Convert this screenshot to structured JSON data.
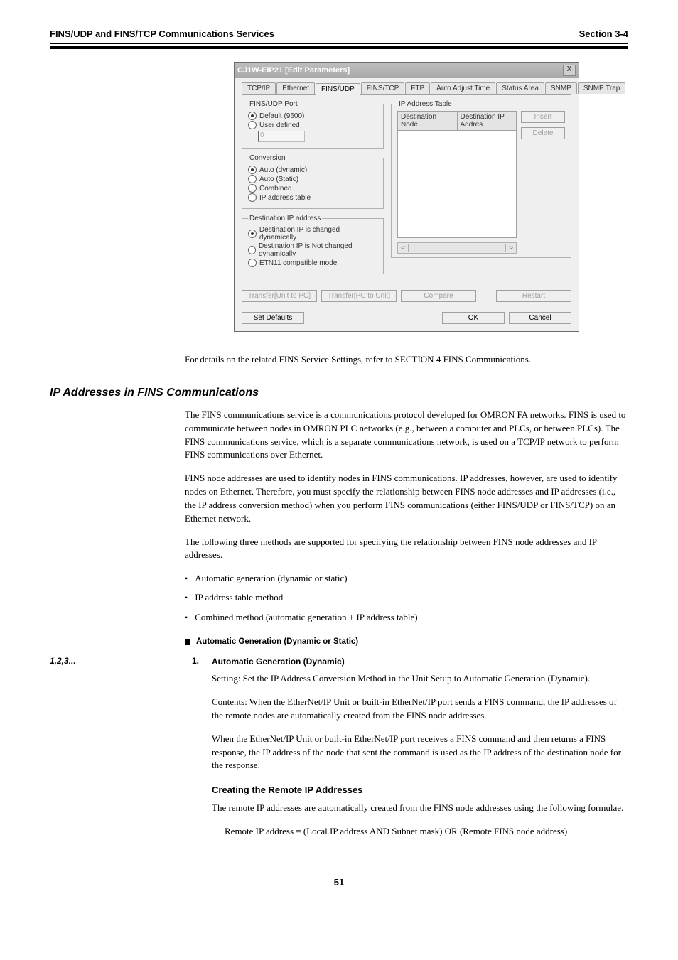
{
  "header": {
    "left": "FINS/UDP and FINS/TCP Communications Services",
    "right": "Section 3-4"
  },
  "dialog": {
    "title": "CJ1W-EIP21 [Edit Parameters]",
    "close": "X",
    "tabs": [
      "TCP/IP",
      "Ethernet",
      "FINS/UDP",
      "FINS/TCP",
      "FTP",
      "Auto Adjust Time",
      "Status Area",
      "SNMP",
      "SNMP Trap"
    ],
    "active_tab_index": 2,
    "fins_udp_port": {
      "legend": "FINS/UDP Port",
      "opt1": "Default (9600)",
      "opt2": "User defined",
      "value": "0"
    },
    "conversion": {
      "legend": "Conversion",
      "opt1": "Auto (dynamic)",
      "opt2": "Auto (Static)",
      "opt3": "Combined",
      "opt4": "IP address table"
    },
    "dest_ip": {
      "legend": "Destination IP address",
      "opt1": "Destination IP is changed dynamically",
      "opt2": "Destination IP is Not changed dynamically",
      "opt3": "ETN11 compatible mode"
    },
    "ip_table": {
      "legend": "IP Address Table",
      "col1": "Destination Node...",
      "col2": "Destination IP Addres",
      "btn_insert": "Insert",
      "btn_delete": "Delete"
    },
    "buttons": {
      "transfer_to_pc": "Transfer[Unit to PC]",
      "transfer_to_unit": "Transfer[PC to Unit]",
      "compare": "Compare",
      "restart": "Restart",
      "set_defaults": "Set Defaults",
      "ok": "OK",
      "cancel": "Cancel"
    }
  },
  "body": {
    "para1": "For details on the related FINS Service Settings, refer to SECTION 4 FINS Communications.",
    "section_heading": "IP Addresses in FINS Communications",
    "para2": "The FINS communications service is a communications protocol developed for OMRON FA networks. FINS is used to communicate between nodes in OMRON PLC networks (e.g., between a computer and PLCs, or between PLCs). The FINS communications service, which is a separate communications network, is used on a TCP/IP network to perform FINS communications over Ethernet.",
    "para3": "FINS node addresses are used to identify nodes in FINS communications. IP addresses, however, are used to identify nodes on Ethernet. Therefore, you must specify the relationship between FINS node addresses and IP addresses (i.e., the IP address conversion method) when you perform FINS communications (either FINS/UDP or FINS/TCP) on an Ethernet network.",
    "para4": "The following three methods are supported for specifying the relationship between FINS node addresses and IP addresses.",
    "bullet1": "Automatic generation (dynamic or static)",
    "bullet2": "IP address table method",
    "bullet3": "Combined method (automatic generation + IP address table)",
    "subsection": "Automatic Generation (Dynamic or Static)",
    "num1_label": "1,2,3...",
    "num1": "1.",
    "num1_title": "Automatic Generation (Dynamic)",
    "para5": "Setting: Set the IP Address Conversion Method in the Unit Setup to Automatic Generation (Dynamic).",
    "para6": "Contents: When the EtherNet/IP Unit or built-in EtherNet/IP port sends a FINS command, the IP addresses of the remote nodes are automatically created from the FINS node addresses.",
    "para7": "When the EtherNet/IP Unit or built-in EtherNet/IP port receives a FINS command and then returns a FINS response, the IP address of the node that sent the command is used as the IP address of the destination node for the response.",
    "sub_item_1": "Creating the Remote IP Addresses",
    "para8": "The remote IP addresses are automatically created from the FINS node addresses using the following formulae.",
    "para9": "Remote IP address = (Local IP address AND Subnet mask) OR (Remote FINS node address)"
  },
  "footer": {
    "page": "51"
  }
}
